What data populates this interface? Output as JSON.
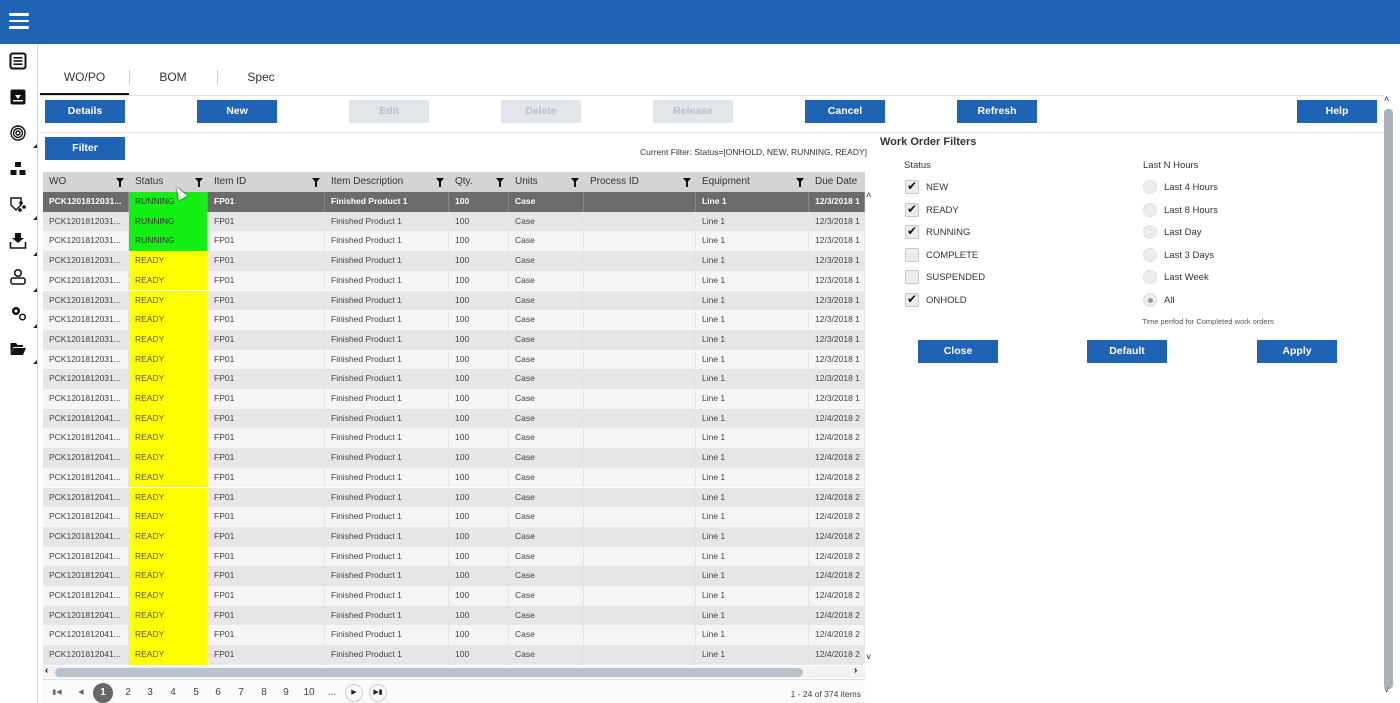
{
  "topbar": {
    "menu_icon": "hamburger-icon",
    "color": "#1f63b4"
  },
  "sidebar": {
    "items": [
      {
        "icon": "list-icon",
        "has_submenu": false
      },
      {
        "icon": "inbox-download-icon",
        "has_submenu": false
      },
      {
        "icon": "fingerprint-icon",
        "has_submenu": true
      },
      {
        "icon": "hierarchy-boxes-icon",
        "has_submenu": false
      },
      {
        "icon": "quality-network-icon",
        "has_submenu": true
      },
      {
        "icon": "download-tray-icon",
        "has_submenu": true
      },
      {
        "icon": "user-icon",
        "has_submenu": true
      },
      {
        "icon": "gears-icon",
        "has_submenu": true
      },
      {
        "icon": "folder-open-icon",
        "has_submenu": true
      }
    ]
  },
  "tabs": [
    {
      "label": "WO/PO",
      "active": true
    },
    {
      "label": "BOM",
      "active": false
    },
    {
      "label": "Spec",
      "active": false
    }
  ],
  "toolbar": {
    "details": "Details",
    "new": "New",
    "edit": "Edit",
    "delete": "Delete",
    "release": "Release",
    "cancel": "Cancel",
    "refresh": "Refresh",
    "help": "Help",
    "filter": "Filter"
  },
  "current_filter": "Current Filter: Status=[ONHOLD, NEW, RUNNING, READY]",
  "grid": {
    "columns": [
      "WO",
      "Status",
      "Item ID",
      "Item Description",
      "Qty.",
      "Units",
      "Process ID",
      "Equipment",
      "Due Date"
    ],
    "rows": [
      [
        "PCK1201812031...",
        "RUNNING",
        "FP01",
        "Finished Product 1",
        "100",
        "Case",
        "",
        "Line 1",
        "12/3/2018 1"
      ],
      [
        "PCK1201812031...",
        "RUNNING",
        "FP01",
        "Finished Product 1",
        "100",
        "Case",
        "",
        "Line 1",
        "12/3/2018 1"
      ],
      [
        "PCK1201812031...",
        "RUNNING",
        "FP01",
        "Finished Product 1",
        "100",
        "Case",
        "",
        "Line 1",
        "12/3/2018 1"
      ],
      [
        "PCK1201812031...",
        "READY",
        "FP01",
        "Finished Product 1",
        "100",
        "Case",
        "",
        "Line 1",
        "12/3/2018 1"
      ],
      [
        "PCK1201812031...",
        "READY",
        "FP01",
        "Finished Product 1",
        "100",
        "Case",
        "",
        "Line 1",
        "12/3/2018 1"
      ],
      [
        "PCK1201812031...",
        "READY",
        "FP01",
        "Finished Product 1",
        "100",
        "Case",
        "",
        "Line 1",
        "12/3/2018 1"
      ],
      [
        "PCK1201812031...",
        "READY",
        "FP01",
        "Finished Product 1",
        "100",
        "Case",
        "",
        "Line 1",
        "12/3/2018 1"
      ],
      [
        "PCK1201812031...",
        "READY",
        "FP01",
        "Finished Product 1",
        "100",
        "Case",
        "",
        "Line 1",
        "12/3/2018 1"
      ],
      [
        "PCK1201812031...",
        "READY",
        "FP01",
        "Finished Product 1",
        "100",
        "Case",
        "",
        "Line 1",
        "12/3/2018 1"
      ],
      [
        "PCK1201812031...",
        "READY",
        "FP01",
        "Finished Product 1",
        "100",
        "Case",
        "",
        "Line 1",
        "12/3/2018 1"
      ],
      [
        "PCK1201812031...",
        "READY",
        "FP01",
        "Finished Product 1",
        "100",
        "Case",
        "",
        "Line 1",
        "12/3/2018 1"
      ],
      [
        "PCK1201812041...",
        "READY",
        "FP01",
        "Finished Product 1",
        "100",
        "Case",
        "",
        "Line 1",
        "12/4/2018 2"
      ],
      [
        "PCK1201812041...",
        "READY",
        "FP01",
        "Finished Product 1",
        "100",
        "Case",
        "",
        "Line 1",
        "12/4/2018 2"
      ],
      [
        "PCK1201812041...",
        "READY",
        "FP01",
        "Finished Product 1",
        "100",
        "Case",
        "",
        "Line 1",
        "12/4/2018 2"
      ],
      [
        "PCK1201812041...",
        "READY",
        "FP01",
        "Finished Product 1",
        "100",
        "Case",
        "",
        "Line 1",
        "12/4/2018 2"
      ],
      [
        "PCK1201812041...",
        "READY",
        "FP01",
        "Finished Product 1",
        "100",
        "Case",
        "",
        "Line 1",
        "12/4/2018 2"
      ],
      [
        "PCK1201812041...",
        "READY",
        "FP01",
        "Finished Product 1",
        "100",
        "Case",
        "",
        "Line 1",
        "12/4/2018 2"
      ],
      [
        "PCK1201812041...",
        "READY",
        "FP01",
        "Finished Product 1",
        "100",
        "Case",
        "",
        "Line 1",
        "12/4/2018 2"
      ],
      [
        "PCK1201812041...",
        "READY",
        "FP01",
        "Finished Product 1",
        "100",
        "Case",
        "",
        "Line 1",
        "12/4/2018 2"
      ],
      [
        "PCK1201812041...",
        "READY",
        "FP01",
        "Finished Product 1",
        "100",
        "Case",
        "",
        "Line 1",
        "12/4/2018 2"
      ],
      [
        "PCK1201812041...",
        "READY",
        "FP01",
        "Finished Product 1",
        "100",
        "Case",
        "",
        "Line 1",
        "12/4/2018 2"
      ],
      [
        "PCK1201812041...",
        "READY",
        "FP01",
        "Finished Product 1",
        "100",
        "Case",
        "",
        "Line 1",
        "12/4/2018 2"
      ],
      [
        "PCK1201812041...",
        "READY",
        "FP01",
        "Finished Product 1",
        "100",
        "Case",
        "",
        "Line 1",
        "12/4/2018 2"
      ],
      [
        "PCK1201812041...",
        "READY",
        "FP01",
        "Finished Product 1",
        "100",
        "Case",
        "",
        "Line 1",
        "12/4/2018 2"
      ]
    ],
    "selected_row": 0,
    "status_colors": {
      "RUNNING": "#14f014",
      "READY": "#ffff00"
    }
  },
  "pager": {
    "pages": [
      "1",
      "2",
      "3",
      "4",
      "5",
      "6",
      "7",
      "8",
      "9",
      "10",
      "..."
    ],
    "current": "1",
    "info": "1 - 24 of 374 items"
  },
  "filters": {
    "title": "Work Order Filters",
    "status_label": "Status",
    "status_options": [
      {
        "label": "NEW",
        "checked": true
      },
      {
        "label": "READY",
        "checked": true
      },
      {
        "label": "RUNNING",
        "checked": true
      },
      {
        "label": "COMPLETE",
        "checked": false
      },
      {
        "label": "SUSPENDED",
        "checked": false
      },
      {
        "label": "ONHOLD",
        "checked": true
      }
    ],
    "hours_label": "Last N Hours",
    "hours_options": [
      {
        "label": "Last 4 Hours",
        "selected": false
      },
      {
        "label": "Last 8 Hours",
        "selected": false
      },
      {
        "label": "Last Day",
        "selected": false
      },
      {
        "label": "Last 3 Days",
        "selected": false
      },
      {
        "label": "Last Week",
        "selected": false
      },
      {
        "label": "All",
        "selected": true
      }
    ],
    "hint": "Time perifod for Completed work orders",
    "close": "Close",
    "default": "Default",
    "apply": "Apply"
  }
}
